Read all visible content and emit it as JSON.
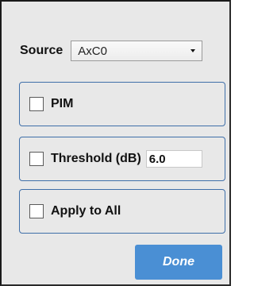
{
  "source": {
    "label": "Source",
    "selected": "AxC0"
  },
  "options": {
    "pim": {
      "label": "PIM",
      "checked": false
    },
    "threshold": {
      "label": "Threshold (dB)",
      "checked": false,
      "value": "6.0"
    },
    "apply_all": {
      "label": "Apply to All",
      "checked": false
    }
  },
  "done_label": "Done",
  "colors": {
    "group_border": "#3f6fa9",
    "button_bg": "#4a8fd4",
    "panel_bg": "#e8e8e8"
  }
}
